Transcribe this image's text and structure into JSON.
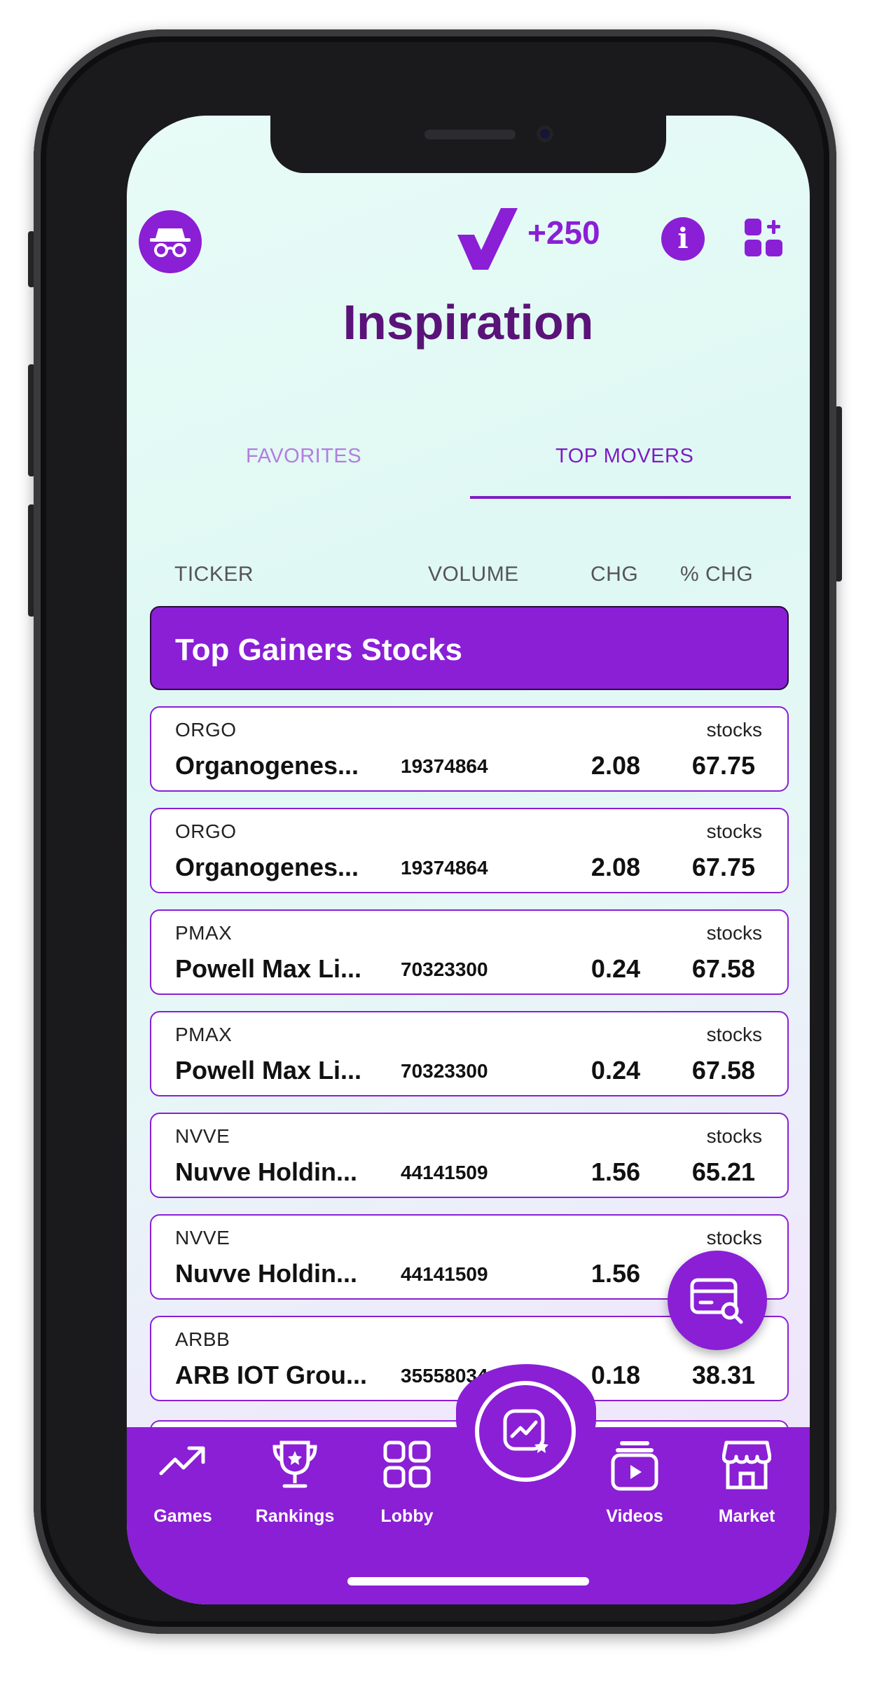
{
  "header": {
    "points": "+250",
    "title": "Inspiration",
    "spy_icon": "incognito-icon",
    "info_icon": "info-icon",
    "info_glyph": "i",
    "widgets_icon": "add-widget-icon"
  },
  "tabs": [
    {
      "label": "FAVORITES",
      "active": false
    },
    {
      "label": "TOP MOVERS",
      "active": true
    }
  ],
  "columns": [
    "TICKER",
    "VOLUME",
    "CHG",
    "% CHG"
  ],
  "section_title": "Top Gainers Stocks",
  "rows": [
    {
      "ticker": "ORGO",
      "type": "stocks",
      "name": "Organogenes...",
      "volume": "19374864",
      "chg": "2.08",
      "pct": "67.75"
    },
    {
      "ticker": "ORGO",
      "type": "stocks",
      "name": "Organogenes...",
      "volume": "19374864",
      "chg": "2.08",
      "pct": "67.75"
    },
    {
      "ticker": "PMAX",
      "type": "stocks",
      "name": "Powell Max Li...",
      "volume": "70323300",
      "chg": "0.24",
      "pct": "67.58"
    },
    {
      "ticker": "PMAX",
      "type": "stocks",
      "name": "Powell Max Li...",
      "volume": "70323300",
      "chg": "0.24",
      "pct": "67.58"
    },
    {
      "ticker": "NVVE",
      "type": "stocks",
      "name": "Nuvve Holdin...",
      "volume": "44141509",
      "chg": "1.56",
      "pct": "65.21"
    },
    {
      "ticker": "NVVE",
      "type": "stocks",
      "name": "Nuvve Holdin...",
      "volume": "44141509",
      "chg": "1.56",
      "pct": ""
    },
    {
      "ticker": "ARBB",
      "type": "",
      "name": "ARB IOT Grou...",
      "volume": "35558034",
      "chg": "0.18",
      "pct": "38.31"
    }
  ],
  "fab_icon": "card-search-icon",
  "nav": {
    "items": [
      {
        "label": "Games",
        "icon": "trending-up-icon"
      },
      {
        "label": "Rankings",
        "icon": "trophy-icon"
      },
      {
        "label": "Lobby",
        "icon": "grid-icon"
      },
      {
        "label": "Videos",
        "icon": "video-play-icon"
      },
      {
        "label": "Market",
        "icon": "storefront-icon"
      }
    ],
    "center_icon": "chart-star-icon"
  },
  "colors": {
    "accent": "#8a1fd6",
    "title": "#5a1378"
  }
}
